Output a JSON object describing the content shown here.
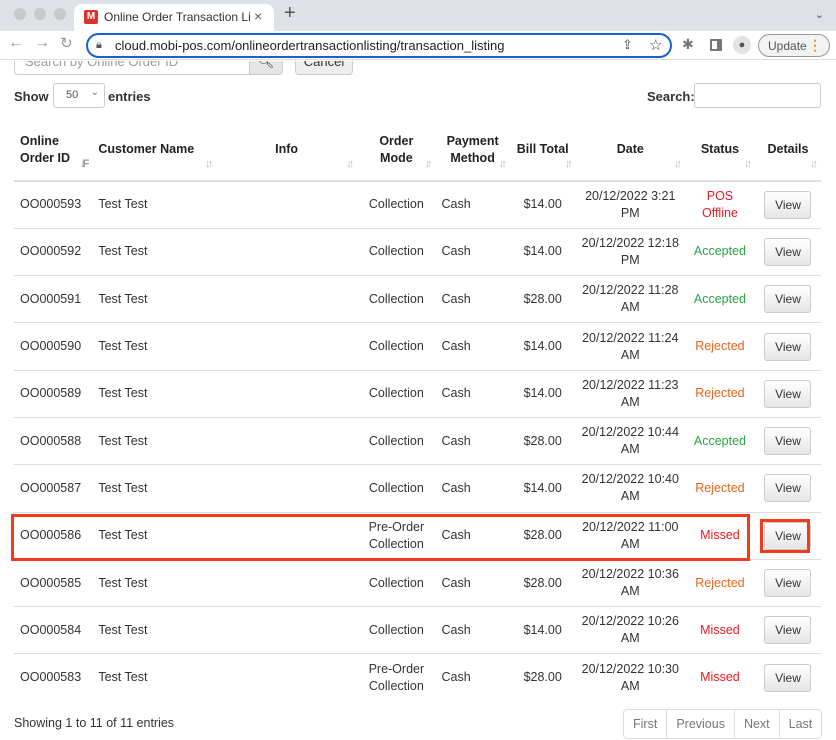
{
  "browser": {
    "tab_title": "Online Order Transaction Listing",
    "favicon_letter": "M",
    "url": "cloud.mobi-pos.com/onlineordertransactionlisting/transaction_listing",
    "update_label": "Update"
  },
  "top_search": {
    "placeholder": "Search by Online Order ID",
    "search_icon": "search-icon",
    "cancel_label": "Cancel"
  },
  "length": {
    "show_label": "Show",
    "value": "50",
    "entries_label": "entries"
  },
  "filter": {
    "label": "Search:",
    "value": ""
  },
  "table": {
    "columns": [
      {
        "key": "id",
        "label": "Online Order ID"
      },
      {
        "key": "customer",
        "label": "Customer Name"
      },
      {
        "key": "info",
        "label": "Info"
      },
      {
        "key": "mode",
        "label": "Order Mode"
      },
      {
        "key": "payment",
        "label": "Payment Method"
      },
      {
        "key": "bill",
        "label": "Bill Total"
      },
      {
        "key": "date",
        "label": "Date"
      },
      {
        "key": "status",
        "label": "Status"
      },
      {
        "key": "details",
        "label": "Details"
      }
    ],
    "rows": [
      {
        "id": "OO000593",
        "customer": "Test Test",
        "info": "",
        "mode": "Collection",
        "payment": "Cash",
        "bill": "$14.00",
        "date": "20/12/2022 3:21 PM",
        "status": "POS Offline",
        "status_type": "offline",
        "details": "View"
      },
      {
        "id": "OO000592",
        "customer": "Test Test",
        "info": "",
        "mode": "Collection",
        "payment": "Cash",
        "bill": "$14.00",
        "date": "20/12/2022 12:18 PM",
        "status": "Accepted",
        "status_type": "accepted",
        "details": "View"
      },
      {
        "id": "OO000591",
        "customer": "Test Test",
        "info": "",
        "mode": "Collection",
        "payment": "Cash",
        "bill": "$28.00",
        "date": "20/12/2022 11:28 AM",
        "status": "Accepted",
        "status_type": "accepted",
        "details": "View"
      },
      {
        "id": "OO000590",
        "customer": "Test Test",
        "info": "",
        "mode": "Collection",
        "payment": "Cash",
        "bill": "$14.00",
        "date": "20/12/2022 11:24 AM",
        "status": "Rejected",
        "status_type": "rejected",
        "details": "View"
      },
      {
        "id": "OO000589",
        "customer": "Test Test",
        "info": "",
        "mode": "Collection",
        "payment": "Cash",
        "bill": "$14.00",
        "date": "20/12/2022 11:23 AM",
        "status": "Rejected",
        "status_type": "rejected",
        "details": "View"
      },
      {
        "id": "OO000588",
        "customer": "Test Test",
        "info": "",
        "mode": "Collection",
        "payment": "Cash",
        "bill": "$28.00",
        "date": "20/12/2022 10:44 AM",
        "status": "Accepted",
        "status_type": "accepted",
        "details": "View"
      },
      {
        "id": "OO000587",
        "customer": "Test Test",
        "info": "",
        "mode": "Collection",
        "payment": "Cash",
        "bill": "$14.00",
        "date": "20/12/2022 10:40 AM",
        "status": "Rejected",
        "status_type": "rejected",
        "details": "View"
      },
      {
        "id": "OO000586",
        "customer": "Test Test",
        "info": "",
        "mode": "Pre-Order Collection",
        "payment": "Cash",
        "bill": "$28.00",
        "date": "20/12/2022 11:00 AM",
        "status": "Missed",
        "status_type": "missed",
        "details": "View",
        "highlighted": true
      },
      {
        "id": "OO000585",
        "customer": "Test Test",
        "info": "",
        "mode": "Collection",
        "payment": "Cash",
        "bill": "$28.00",
        "date": "20/12/2022 10:36 AM",
        "status": "Rejected",
        "status_type": "rejected",
        "details": "View"
      },
      {
        "id": "OO000584",
        "customer": "Test Test",
        "info": "",
        "mode": "Collection",
        "payment": "Cash",
        "bill": "$14.00",
        "date": "20/12/2022 10:26 AM",
        "status": "Missed",
        "status_type": "missed",
        "details": "View"
      },
      {
        "id": "OO000583",
        "customer": "Test Test",
        "info": "",
        "mode": "Pre-Order Collection",
        "payment": "Cash",
        "bill": "$28.00",
        "date": "20/12/2022 10:30 AM",
        "status": "Missed",
        "status_type": "missed",
        "details": "View"
      }
    ]
  },
  "status_colors": {
    "accepted": "#28a745",
    "rejected": "#e8641b",
    "missed": "#f0191e",
    "offline": "#f0191e"
  },
  "annotation_color": "#f23b1e",
  "footer": {
    "info": "Showing 1 to 11 of 11 entries",
    "pager": [
      "First",
      "Previous",
      "Next",
      "Last"
    ]
  }
}
